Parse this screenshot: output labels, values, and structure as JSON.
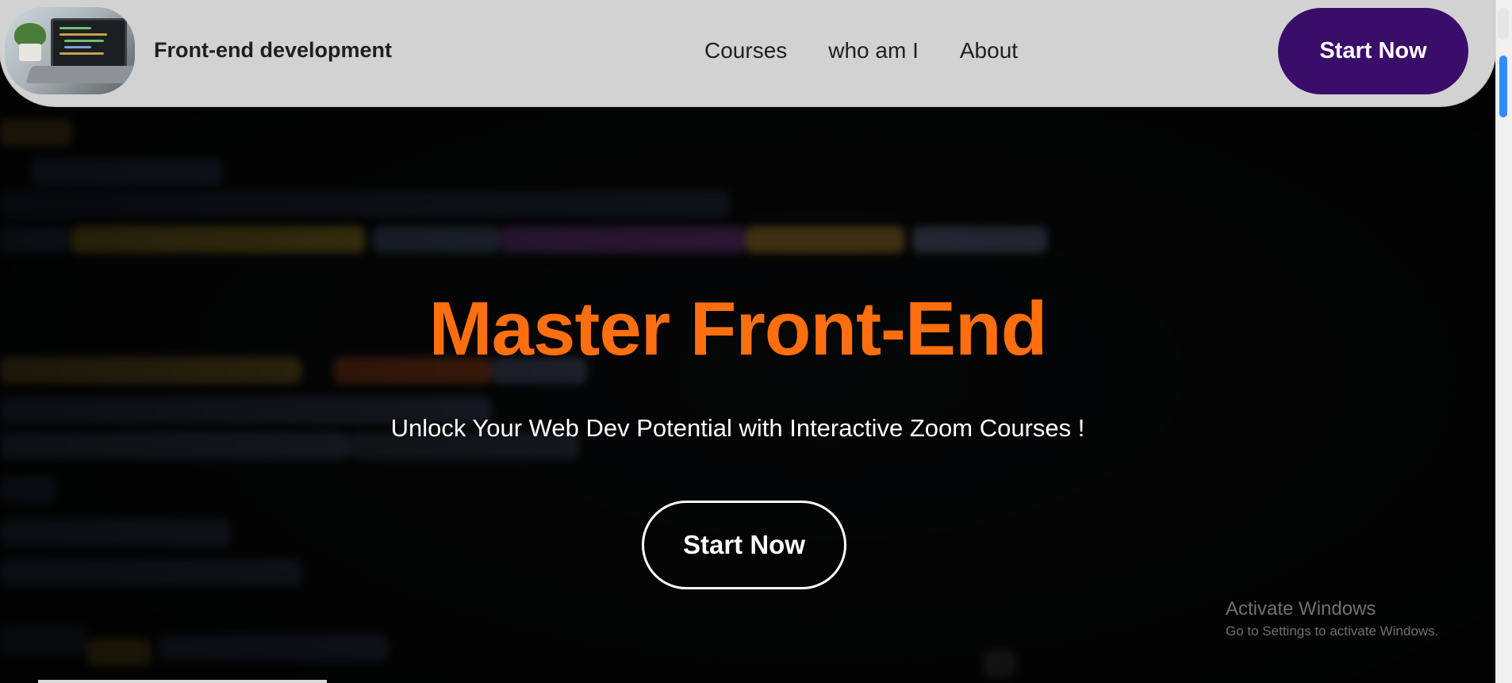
{
  "navbar": {
    "logo_icon": "laptop-logo",
    "brand_title": "Front-end development",
    "links": [
      {
        "label": "Courses"
      },
      {
        "label": "who am I"
      },
      {
        "label": "About"
      }
    ],
    "cta_label": "Start Now",
    "cta_color": "#3a0d6b"
  },
  "hero": {
    "title": "Master Front-End",
    "title_color": "#ff6f0f",
    "subtitle": "Unlock Your Web Dev Potential with Interactive Zoom Courses !",
    "cta_label": "Start Now"
  },
  "watermark": {
    "title": "Activate Windows",
    "subtitle": "Go to Settings to activate Windows."
  },
  "scrollbar": {
    "thumb_color": "#2f8cff"
  }
}
